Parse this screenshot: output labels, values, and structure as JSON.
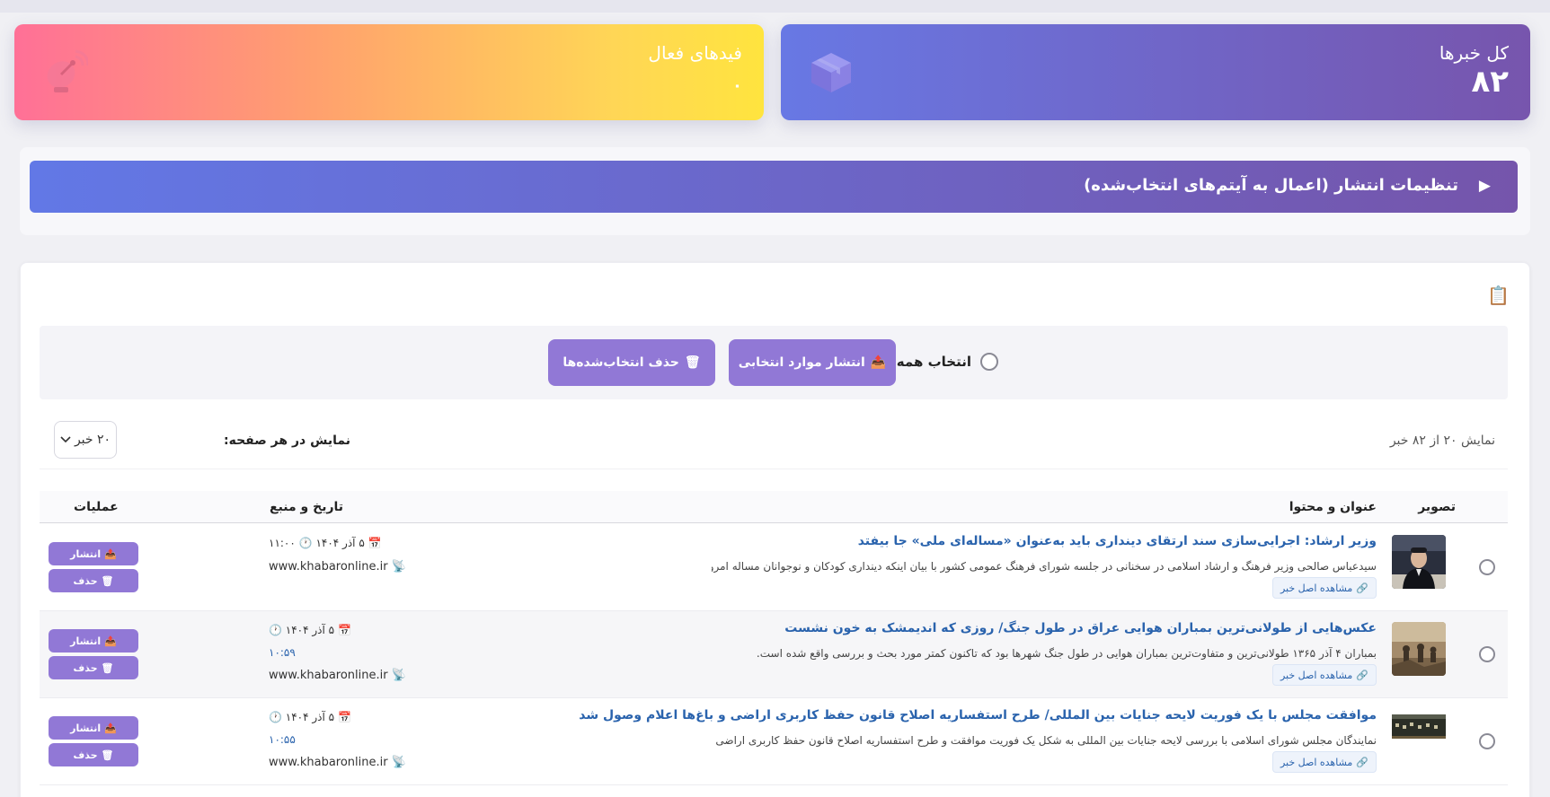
{
  "stats": {
    "total_label": "کل خبرها",
    "total_value": "۸۲",
    "total_icon": "package-icon",
    "feeds_label": "فیدهای فعال",
    "feeds_value": "۰",
    "feeds_icon": "satellite-dish-icon"
  },
  "settings": {
    "arrow": "▶",
    "title": "تنظیمات انتشار (اعمال به آیتم‌های انتخاب‌شده)"
  },
  "bulk": {
    "select_all_label": "انتخاب همه",
    "publish_selected_label": "انتشار موارد انتخابی",
    "delete_selected_label": "حذف انتخاب‌شده‌ها"
  },
  "pager": {
    "count_text": "نمایش ۲۰ از ۸۲ خبر",
    "per_page_label": "نمایش در هر صفحه:",
    "per_page_value": "۲۰ خبر"
  },
  "table": {
    "headers": {
      "image": "تصویر",
      "title": "عنوان و محتوا",
      "date": "تاریخ و منبع",
      "ops": "عملیات"
    },
    "view_original_label": "مشاهده اصل خبر",
    "publish_label": "انتشار",
    "delete_label": "حذف",
    "rows": [
      {
        "title": "وزیر ارشاد: اجرایی‌سازی سند ارتقای دینداری باید به‌عنوان «مساله‌ای ملی» جا بیفتد",
        "summary": "سیدعباس صالحی وزیر فرهنگ و ارشاد اسلامی در سخنانی در جلسه شورای فرهنگ عمومی کشور با بیان اینکه دینداری کودکان و نوجوانان مساله امروز و...",
        "date": "۵ آذر ۱۴۰۴",
        "time": "۱۱:۰۰",
        "time_alt": "۱۱:۰۰",
        "source": "www.khabaronline.ir"
      },
      {
        "title": "عکس‌هایی از طولانی‌ترین بمباران هوایی عراق در طول جنگ/ روزی که اندیمشک به خون نشست",
        "summary": "بمباران ۴ آذر ۱۳۶۵ طولانی‌ترین و متفاوت‌ترین بمباران هوایی در طول جنگ شهرها بود که تاکنون کمتر مورد بحث و بررسی واقع شده است.",
        "date": "۵ آذر ۱۴۰۴",
        "time": "۱۰:۵۹",
        "time_alt": "۱۰:۵۹",
        "source": "www.khabaronline.ir"
      },
      {
        "title": "موافقت مجلس با یک فوریت لایحه جنایات بین المللی/ طرح استفساریه اصلاح قانون حفظ کاربری اراضی و باغ‌ها اعلام وصول شد",
        "summary": "نمایندگان مجلس شورای اسلامی با بررسی لایحه جنایات بین المللی به شکل یک فوریت موافقت و طرح استفساریه اصلاح قانون حفظ کاربری اراضی و باغ‌ها...",
        "date": "۵ آذر ۱۴۰۴",
        "time": "۱۰:۵۵",
        "time_alt": "۱۰:۵۵",
        "source": "www.khabaronline.ir"
      }
    ]
  }
}
